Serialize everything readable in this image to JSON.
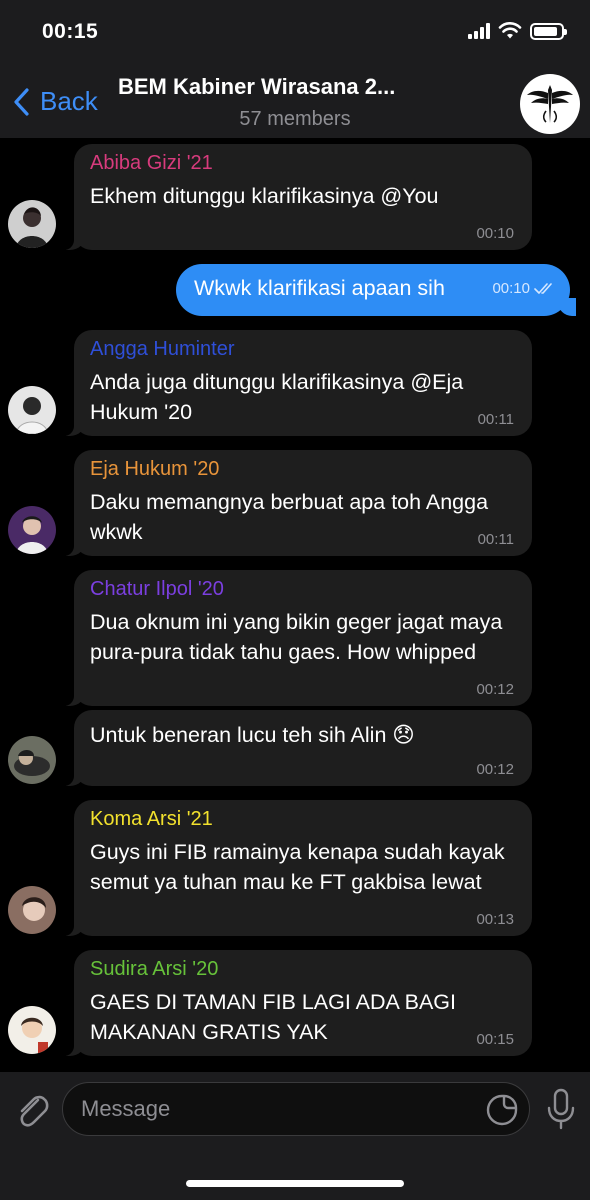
{
  "status_bar": {
    "time": "00:15",
    "battery_level_percent": 90
  },
  "header": {
    "back_label": "Back",
    "title": "BEM Kabiner Wirasana 2...",
    "subtitle": "57 members"
  },
  "messages": [
    {
      "sender": "Abiba Gizi '21",
      "sender_color": "#d83b7d",
      "text": "Ekhem ditunggu klarifikasinya @You",
      "time": "00:10"
    },
    {
      "outgoing": true,
      "text": "Wkwk klarifikasi apaan sih",
      "time": "00:10",
      "status": "read"
    },
    {
      "sender": "Angga Huminter",
      "sender_color": "#2f4fd8",
      "text": "Anda juga ditunggu klarifikasinya @Eja Hukum '20",
      "time": "00:11"
    },
    {
      "sender": "Eja Hukum '20",
      "sender_color": "#e8943a",
      "text": "Daku memangnya berbuat apa toh Angga wkwk",
      "time": "00:11"
    },
    {
      "sender": "Chatur Ilpol '20",
      "sender_color": "#7b3fe0",
      "text": "Dua oknum ini yang bikin geger jagat maya pura-pura tidak tahu gaes. How whipped",
      "time": "00:12"
    },
    {
      "sender": "",
      "text": "Untuk beneran lucu teh sih Alin 😞",
      "time": "00:12"
    },
    {
      "sender": "Koma Arsi '21",
      "sender_color": "#f2e12d",
      "text": "Guys ini FIB ramainya kenapa sudah kayak semut ya tuhan mau ke FT gakbisa lewat",
      "time": "00:13"
    },
    {
      "sender": "Sudira Arsi '20",
      "sender_color": "#67c23a",
      "text": "GAES DI TAMAN FIB LAGI ADA BAGI MAKANAN GRATIS YAK",
      "time": "00:15"
    }
  ],
  "input": {
    "placeholder": "Message"
  },
  "colors": {
    "accent": "#3e8ef7",
    "outgoing_bubble": "#2e8df5",
    "incoming_bubble": "#1e1e1e"
  }
}
